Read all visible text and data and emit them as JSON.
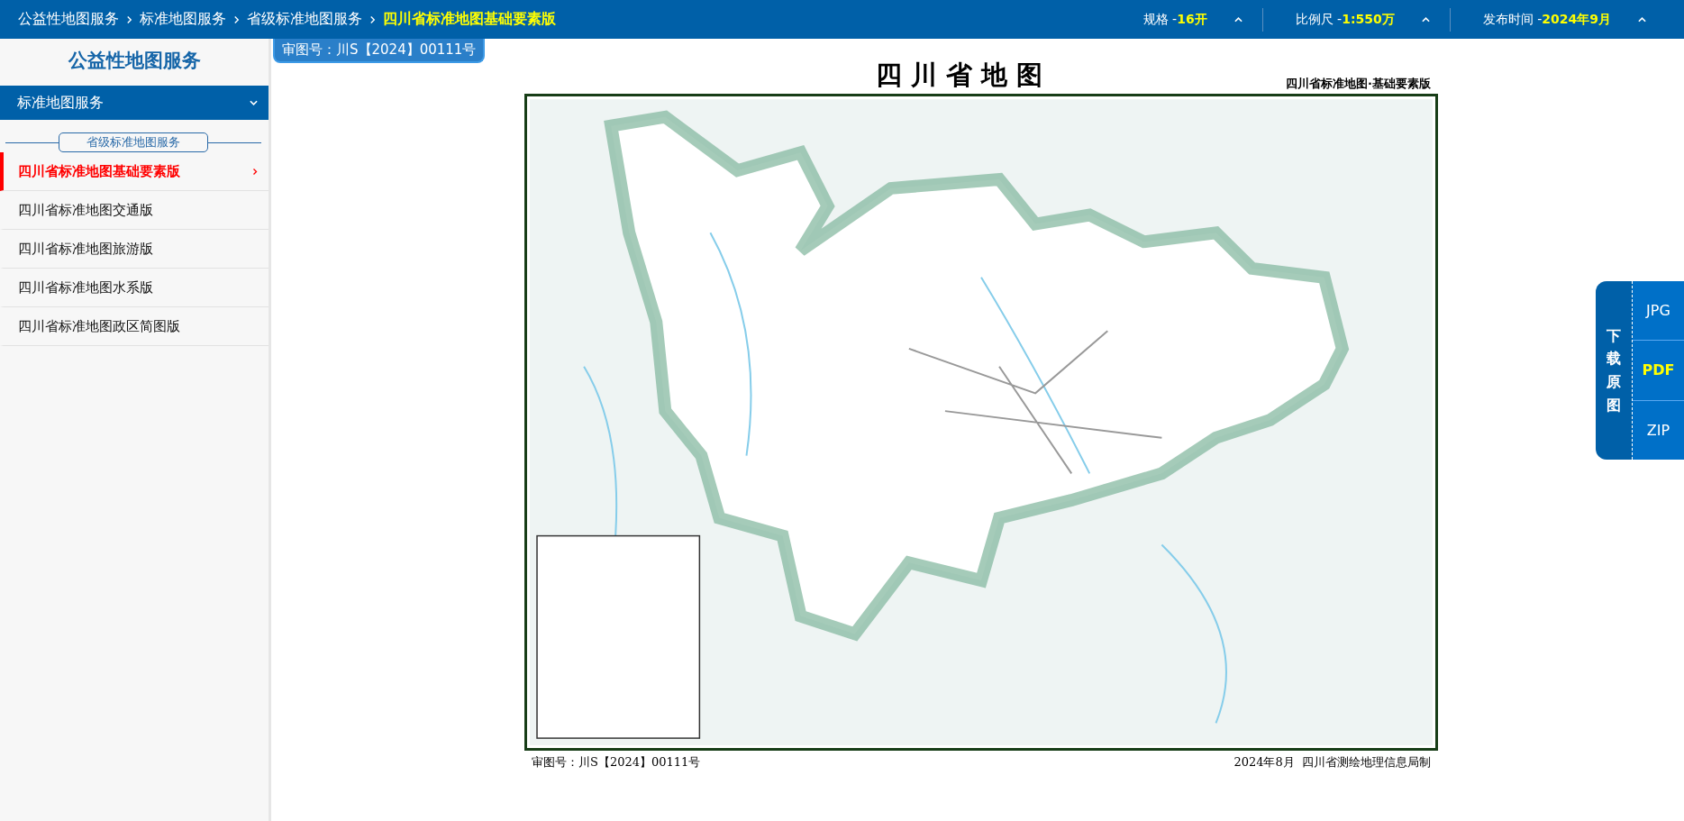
{
  "breadcrumbs": [
    {
      "label": "公益性地图服务",
      "selected": false
    },
    {
      "label": "标准地图服务",
      "selected": false
    },
    {
      "label": "省级标准地图服务",
      "selected": false
    },
    {
      "label": "四川省标准地图基础要素版",
      "selected": true
    }
  ],
  "header_filters": [
    {
      "label": "规格 - ",
      "value": "16开"
    },
    {
      "label": "比例尺 -",
      "value": "1:550万"
    },
    {
      "label": "发布时间 -",
      "value": "2024年9月"
    }
  ],
  "sidebar": {
    "title": "公益性地图服务",
    "section": {
      "label": "标准地图服务",
      "expanded": true
    },
    "group_label": "省级标准地图服务",
    "items": [
      {
        "label": "四川省标准地图基础要素版",
        "selected": true
      },
      {
        "label": "四川省标准地图交通版",
        "selected": false
      },
      {
        "label": "四川省标准地图旅游版",
        "selected": false
      },
      {
        "label": "四川省标准地图水系版",
        "selected": false
      },
      {
        "label": "四川省标准地图政区简图版",
        "selected": false
      }
    ]
  },
  "review_badge": "审图号：川S【2024】00111号",
  "map": {
    "title": "四 川 省 地 图",
    "subtitle": "四川省标准地图·基础要素版",
    "footer_left": "审图号：川S【2024】00111号",
    "footer_right": "2024年8月  四川省测绘地理信息局制"
  },
  "download": {
    "label": "下载原图",
    "formats": [
      {
        "label": "JPG",
        "selected": false
      },
      {
        "label": "PDF",
        "selected": true
      },
      {
        "label": "ZIP",
        "selected": false
      }
    ]
  }
}
